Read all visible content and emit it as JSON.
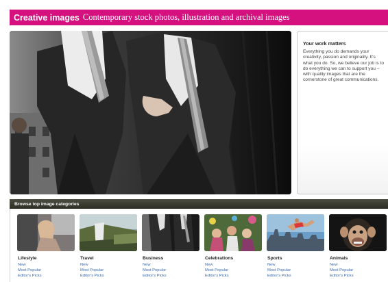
{
  "banner": {
    "brand": "Creative images",
    "tagline": "Contemporary stock photos, illustration and archival images",
    "color": "#d4117f"
  },
  "hero": {
    "image": "businessmen-walking-photo"
  },
  "sidebar": {
    "title": "Your work matters",
    "body": "Everything you do demands your creativity, passion and originality. It's what you do. So, we believe our job is to do everything we can to support you – with quality images that are the cornerstone of great communications."
  },
  "categories": {
    "header": "Browse top image categories",
    "items": [
      {
        "name": "Lifestyle",
        "links": [
          "New",
          "Most Popular",
          "Editor's Picks"
        ],
        "image": "woman-in-car-photo"
      },
      {
        "name": "Travel",
        "links": [
          "New",
          "Most Popular",
          "Editor's Picks"
        ],
        "image": "waterfall-landscape-photo"
      },
      {
        "name": "Business",
        "links": [
          "New",
          "Most Popular",
          "Editor's Picks"
        ],
        "image": "businessmen-walking-photo"
      },
      {
        "name": "Celebrations",
        "links": [
          "New",
          "Most Popular",
          "Editor's Picks"
        ],
        "image": "party-crowd-photo"
      },
      {
        "name": "Sports",
        "links": [
          "New",
          "Most Popular",
          "Editor's Picks"
        ],
        "image": "athlete-jumping-photo"
      },
      {
        "name": "Animals",
        "links": [
          "New",
          "Most Popular",
          "Editor's Picks"
        ],
        "image": "chimpanzee-photo"
      }
    ]
  }
}
